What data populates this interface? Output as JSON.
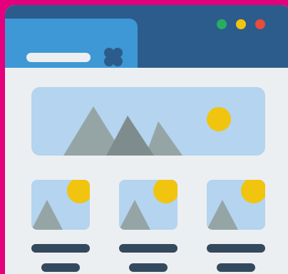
{
  "colors": {
    "background": "#e4007c",
    "titlebar": "#2c5c8b",
    "tab": "#3d98d5",
    "content": "#eceff1",
    "image_bg": "#b4d4f0",
    "mountain_light": "#95a5a6",
    "mountain_dark": "#7f8c8d",
    "sun": "#f1c40f",
    "text_line": "#34495e",
    "btn_green": "#27ae60",
    "btn_yellow": "#f1c40f",
    "btn_red": "#e74c3c"
  },
  "icons": {
    "close": "close-icon",
    "hero": "landscape-image-icon",
    "thumbnail": "landscape-thumbnail-icon"
  },
  "window_buttons": [
    "green",
    "yellow",
    "red"
  ],
  "thumbnails": [
    1,
    2,
    3
  ]
}
